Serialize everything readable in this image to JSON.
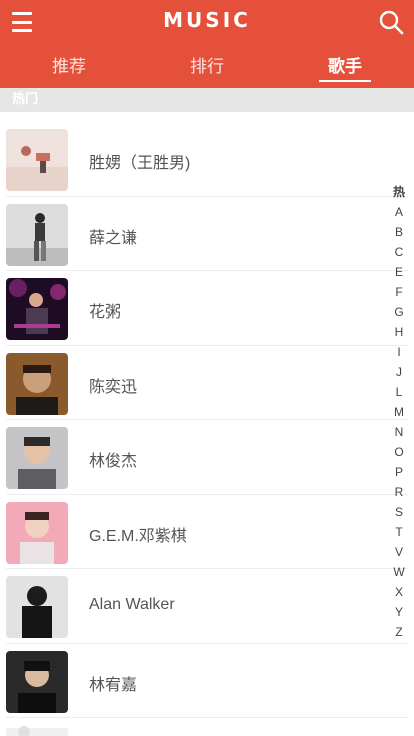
{
  "header": {
    "logo": "MUSIC",
    "menu_icon": "hamburger-icon",
    "search_icon": "search-icon",
    "background": "#e4503a"
  },
  "tabs": [
    {
      "label": "推荐",
      "active": false
    },
    {
      "label": "排行",
      "active": false
    },
    {
      "label": "歌手",
      "active": true
    }
  ],
  "section": {
    "title": "热门"
  },
  "singers": [
    {
      "name": "胜娚（王胜男)"
    },
    {
      "name": "薛之谦"
    },
    {
      "name": "花粥"
    },
    {
      "name": "陈奕迅"
    },
    {
      "name": "林俊杰"
    },
    {
      "name": "G.E.M.邓紫棋"
    },
    {
      "name": "Alan Walker"
    },
    {
      "name": "林宥嘉"
    }
  ],
  "index_bar": [
    "热",
    "A",
    "B",
    "C",
    "E",
    "F",
    "G",
    "H",
    "I",
    "J",
    "L",
    "M",
    "N",
    "O",
    "P",
    "R",
    "S",
    "T",
    "V",
    "W",
    "X",
    "Y",
    "Z"
  ]
}
